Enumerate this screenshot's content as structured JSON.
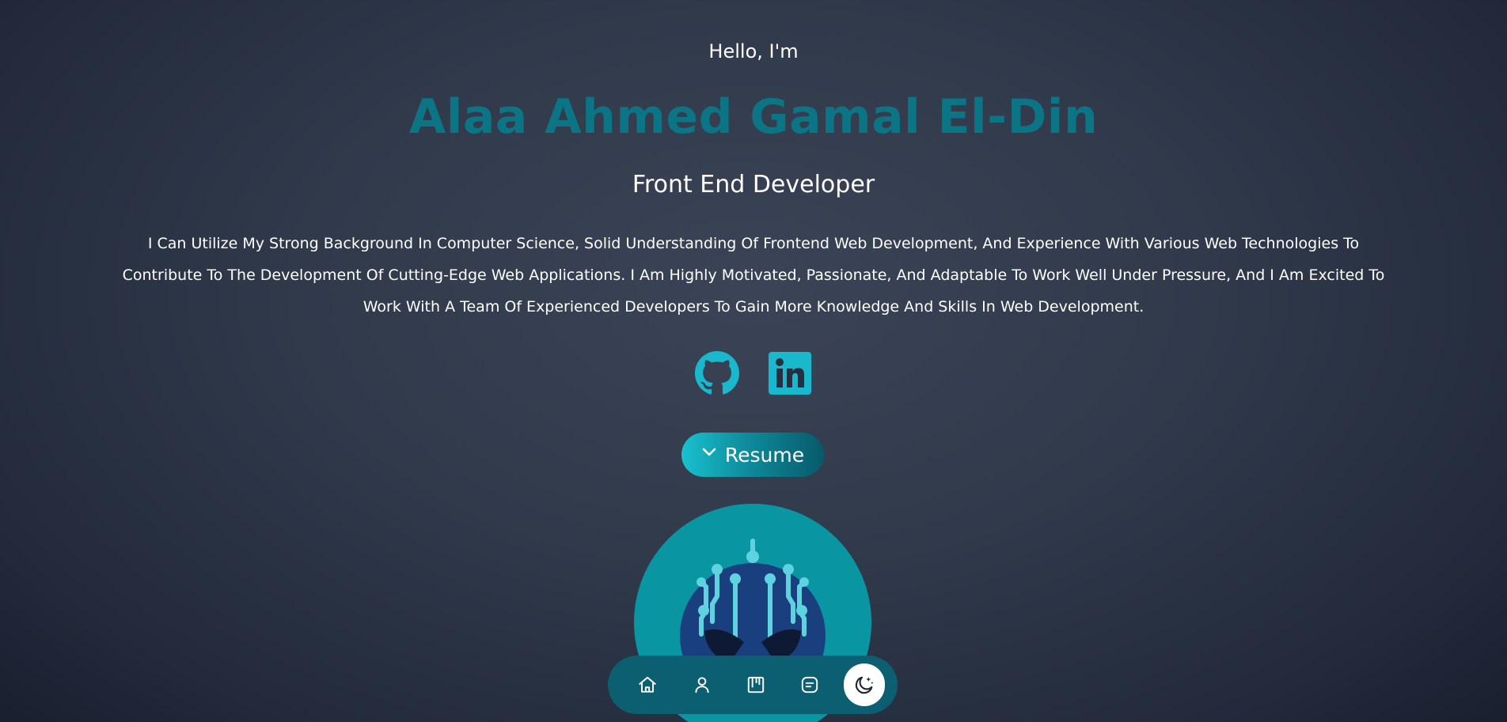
{
  "hero": {
    "greeting": "Hello, I'm",
    "name": "Alaa Ahmed Gamal El-Din",
    "role": "Front End Developer",
    "bio": "I Can Utilize My Strong Background In Computer Science, Solid Understanding Of Frontend Web Development, And Experience With Various Web Technologies To Contribute To The Development Of Cutting-Edge Web Applications. I Am Highly Motivated, Passionate, And Adaptable To Work Well Under Pressure, And I Am Excited To Work With A Team Of Experienced Developers To Gain More Knowledge And Skills In Web Development."
  },
  "socials": [
    {
      "icon": "github-icon"
    },
    {
      "icon": "linkedin-icon"
    }
  ],
  "resume": {
    "label": "Resume",
    "icon": "chevron-down-icon"
  },
  "avatar": {
    "icon": "circuit-brain-avatar"
  },
  "dock": {
    "items": [
      {
        "icon": "home-icon"
      },
      {
        "icon": "user-icon"
      },
      {
        "icon": "kanban-icon"
      },
      {
        "icon": "message-icon"
      },
      {
        "icon": "moon-stars-icon",
        "active": true
      }
    ]
  },
  "colors": {
    "accent": "#0b7585",
    "icon_accent": "#1ab8cc",
    "dock_bg": "#0b5f70",
    "background": "#303a4b"
  }
}
